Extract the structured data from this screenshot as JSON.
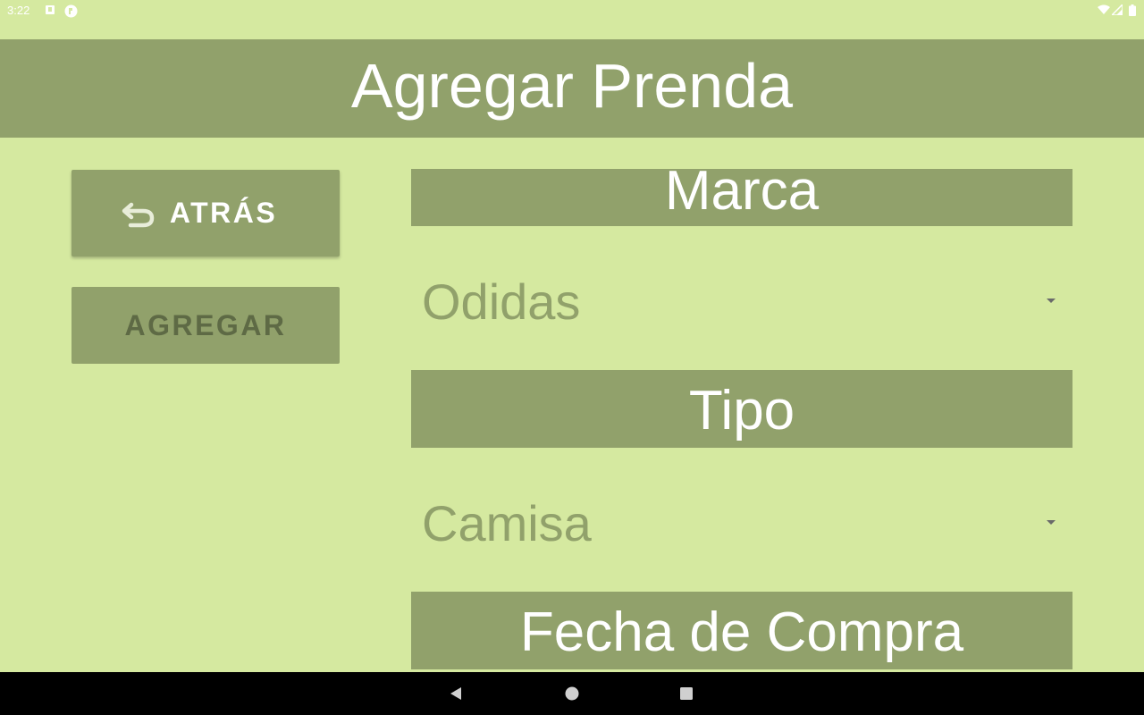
{
  "status_bar": {
    "time": "3:22",
    "icons": [
      "notification-icon",
      "app-icon",
      "wifi-icon",
      "signal-icon",
      "battery-icon"
    ]
  },
  "header": {
    "title": "Agregar Prenda"
  },
  "actions": {
    "back_label": "ATRÁS",
    "back_icon": "undo-icon",
    "add_label": "AGREGAR"
  },
  "form": {
    "brand_label": "Marca",
    "brand_value": "Odidas",
    "type_label": "Tipo",
    "type_value": "Camisa",
    "purchase_date_label": "Fecha de Compra"
  },
  "nav_bar": {
    "buttons": [
      "back-triangle-icon",
      "home-circle-icon",
      "recents-square-icon"
    ]
  },
  "colors": {
    "background": "#d5e9a0",
    "accent": "#91a16b",
    "text_light": "#ffffff",
    "button_text_dark": "#5e6a45"
  }
}
